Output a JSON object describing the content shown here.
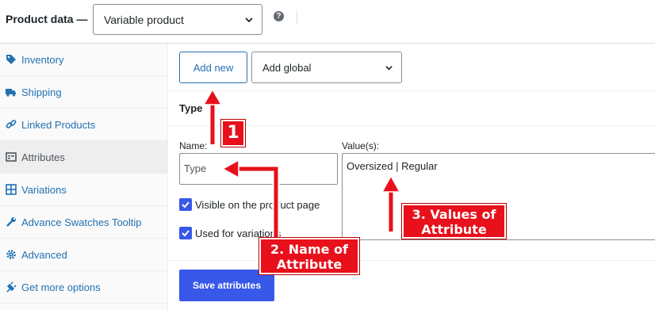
{
  "header": {
    "label": "Product data —",
    "product_type": "Variable product",
    "help_glyph": "?"
  },
  "sidebar": {
    "items": [
      {
        "label": "Inventory",
        "icon": "tag-icon"
      },
      {
        "label": "Shipping",
        "icon": "truck-icon"
      },
      {
        "label": "Linked Products",
        "icon": "link-icon"
      },
      {
        "label": "Attributes",
        "icon": "list-icon",
        "active": true
      },
      {
        "label": "Variations",
        "icon": "grid-icon"
      },
      {
        "label": "Advance Swatches Tooltip",
        "icon": "wrench-icon"
      },
      {
        "label": "Advanced",
        "icon": "gear-icon"
      },
      {
        "label": "Get more options",
        "icon": "plugin-icon"
      }
    ]
  },
  "toolbar": {
    "add_new_label": "Add new",
    "add_global_value": "Add global"
  },
  "attribute": {
    "heading": "Type",
    "name_label": "Name:",
    "name_value": "Type",
    "values_label": "Value(s):",
    "values_value": "Oversized | Regular",
    "visible_label": "Visible on the product page",
    "visible_checked": true,
    "variations_label": "Used for variations",
    "variations_checked": true
  },
  "save_label": "Save attributes",
  "annotations": {
    "tag1": "1",
    "tag2_line1": "2. Name of",
    "tag2_line2": "Attribute",
    "tag3_line1": "3. Values of",
    "tag3_line2": "Attribute"
  },
  "colors": {
    "accent": "#3858e9",
    "link": "#2271b1",
    "annotation": "#e8101b"
  }
}
